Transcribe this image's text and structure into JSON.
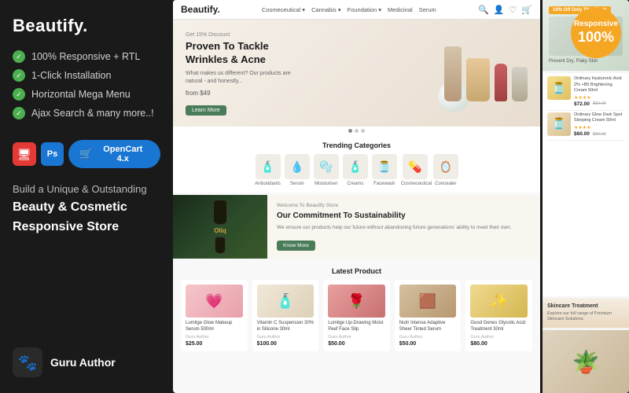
{
  "sidebar": {
    "title": "Beautify.",
    "features": [
      "100% Responsive + RTL",
      "1-Click Installation",
      "Horizontal Mega Menu",
      "Ajax Search & many more..!"
    ],
    "opencart_label": "OpenCart 4.x",
    "tagline": "Build a Unique & Outstanding",
    "category": "Beauty & Cosmetic",
    "store": "Responsive Store",
    "author": "Guru Author",
    "author_icon": "🐾"
  },
  "responsive_badge": {
    "label": "Responsive",
    "percent": "100%"
  },
  "shop": {
    "logo": "Beautify.",
    "nav_items": [
      "Cosmeceutical ▾",
      "Cannabis ▾",
      "Foundation ▾",
      "Medicinal",
      "Serum"
    ],
    "hero": {
      "discount_text": "Get 15% Discount",
      "title": "Proven To Tackle Wrinkles & Acne",
      "subtitle": "What makes us different? Our products are natural - and honestly...",
      "price_label": "from $49",
      "btn_label": "Learn More"
    },
    "trending": {
      "title": "Trending Categories",
      "items": [
        {
          "label": "Antioxidants",
          "icon": "🧴"
        },
        {
          "label": "Serum",
          "icon": "💧"
        },
        {
          "label": "Moisturiser",
          "icon": "🫧"
        },
        {
          "label": "Creams",
          "icon": "🧴"
        },
        {
          "label": "Facewash",
          "icon": "🫙"
        },
        {
          "label": "Cosmeceutical",
          "icon": "💊"
        },
        {
          "label": "Concealer",
          "icon": "🪞"
        }
      ]
    },
    "commitment": {
      "tag": "Welcome To Beautify Store",
      "title": "Our Commitment To Sustainability",
      "desc": "We ensure our products help our future without abandoning future generations' ability to meet their own.",
      "btn_label": "Know More"
    },
    "latest": {
      "title": "Latest Product",
      "products": [
        {
          "name": "Lumilge Glow Makeup Serum 500ml",
          "author": "Guru Author",
          "price": "$25.00",
          "icon": "💗"
        },
        {
          "name": "Vitamin C Suspension 30% in Silicone 30ml",
          "author": "Guru Author",
          "price": "$100.00",
          "icon": "🧴"
        },
        {
          "name": "Lumilge Up-Drawing Moist Peef Face Slip",
          "author": "Guru Author",
          "price": "$50.00",
          "icon": "🌹"
        },
        {
          "name": "Nutri Intense Adaptive Sheer Tinted Serum",
          "author": "Guru Author",
          "price": "$50.00",
          "icon": "🟤"
        },
        {
          "name": "Good Genes Glycolic Acid Treatment 30ml",
          "author": "Guru Author",
          "price": "$80.00",
          "icon": "✨"
        }
      ]
    }
  },
  "right_panel": {
    "offer_badge": "10% Off Only This Week",
    "desc": "Prevent Dry, Flaky Skin",
    "product1": {
      "name": "Ordinary Hyaluronic Acid 2% +B5 Brightening Cream 50ml",
      "rating": "★★★★",
      "price": "$72.00",
      "old_price": "$82.00"
    },
    "product2": {
      "name": "Ordinary Glow Dark Spot Sleeping Cream 50ml",
      "rating": "★★★★",
      "price": "$60.00",
      "old_price": "$80.00"
    },
    "skin_care": {
      "title": "Skincare Treatment",
      "desc": "Explore our full range of Premium Skincare Solutions."
    }
  }
}
